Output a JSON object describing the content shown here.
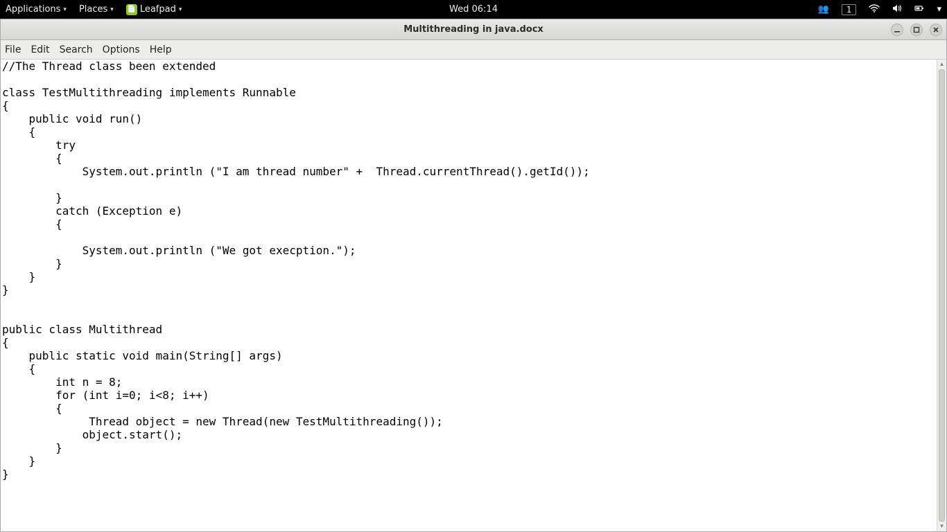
{
  "panel": {
    "applications": "Applications",
    "places": "Places",
    "app_name": "Leafpad",
    "clock": "Wed 06:14",
    "workspace": "1"
  },
  "window": {
    "title": "Multithreading in java.docx"
  },
  "menu": {
    "file": "File",
    "edit": "Edit",
    "search": "Search",
    "options": "Options",
    "help": "Help"
  },
  "editor": {
    "content": "//The Thread class been extended\n\nclass TestMultithreading implements Runnable\n{\n    public void run()\n    {\n        try\n        {\n            System.out.println (\"I am thread number\" +  Thread.currentThread().getId());\n\n        }\n        catch (Exception e)\n        {\n\n            System.out.println (\"We got execption.\");\n        }\n    }\n}\n\n\npublic class Multithread\n{\n    public static void main(String[] args)\n    {\n        int n = 8;\n        for (int i=0; i<8; i++)\n        {\n             Thread object = new Thread(new TestMultithreading());\n            object.start();\n        }\n    }\n}"
  }
}
